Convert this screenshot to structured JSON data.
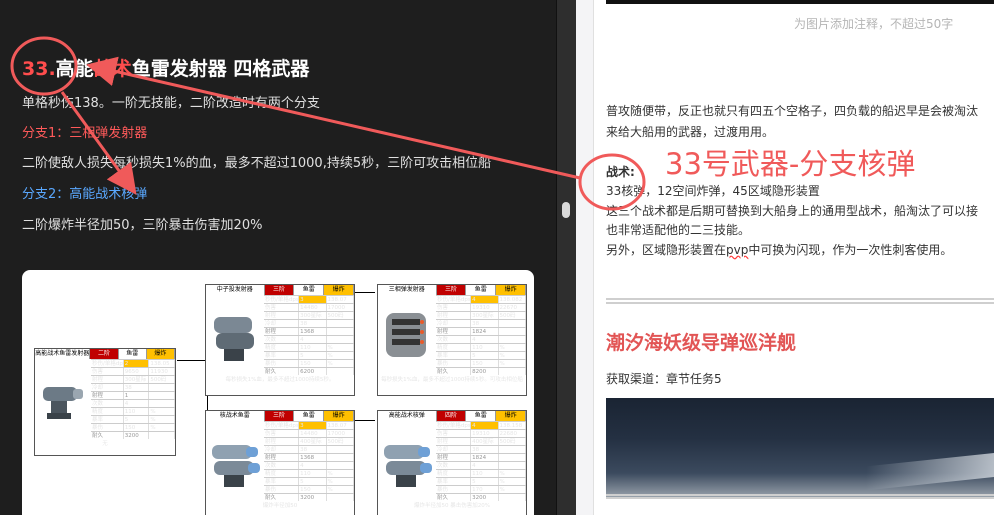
{
  "left": {
    "title_num": "33.",
    "title_a": "高能",
    "title_red": "战术",
    "title_b": "鱼雷发射器  四格武器",
    "line1": "单格秒伤138。一阶无技能，二阶改造时有两个分支",
    "branch1": "分支1：三相弹发射器",
    "line2": "二阶使敌人损失每秒损失1%的血，最多不超过1000,持续5秒，三阶可攻击相位船",
    "branch2": "分支2：高能战术核弹",
    "line3": "二阶爆炸半径加50，三阶暴击伤害加20%"
  },
  "sheets": {
    "main": {
      "name": "高能战术鱼雷发射器",
      "hdr_stage": "二阶",
      "hdr_base": "鱼雷",
      "hdr_var": "爆炸",
      "rows": [
        [
          "秒伤/单格dps",
          "2",
          "138.05"
        ],
        [
          "伤害",
          "9650",
          "11930"
        ],
        [
          "射程",
          "300星际",
          "500码"
        ],
        [
          "冷却",
          "38",
          ""
        ],
        [
          "射程",
          "1",
          ""
        ],
        [
          "次数",
          "4",
          ""
        ],
        [
          "精度",
          "110",
          "%"
        ],
        [
          "暴率",
          "5",
          "%"
        ],
        [
          "暴伤",
          "150",
          "%"
        ],
        [
          "耐久",
          "3200",
          ""
        ]
      ],
      "note": "无"
    },
    "mid_top": {
      "name": "中子投发射器",
      "hdr_stage": "三阶",
      "hdr_base": "鱼雷",
      "hdr_var": "爆炸",
      "rows": [
        [
          "秒伤/单格dps",
          "3",
          "138.07"
        ],
        [
          "伤害",
          "14480",
          "17000"
        ],
        [
          "射程",
          "300星际",
          "500码"
        ],
        [
          "冷却",
          "38",
          ""
        ],
        [
          "射程",
          "1368",
          ""
        ],
        [
          "次数",
          "4",
          ""
        ],
        [
          "精度",
          "110",
          "%"
        ],
        [
          "暴率",
          "5",
          "%"
        ],
        [
          "暴伤",
          "150",
          "%"
        ],
        [
          "耐久",
          "6200",
          ""
        ]
      ],
      "note": "每秒损失1%血，最多不超过1000持续5秒。"
    },
    "right_top": {
      "name": "三相弹发射器",
      "hdr_stage": "三阶",
      "hdr_base": "鱼雷",
      "hdr_var": "爆炸",
      "rows": [
        [
          "秒伤/单格dps",
          "4",
          "138.082"
        ],
        [
          "伤害",
          "19310",
          "22670"
        ],
        [
          "射程",
          "300星际",
          "500码"
        ],
        [
          "冷却",
          "38",
          ""
        ],
        [
          "射程",
          "1824",
          ""
        ],
        [
          "次数",
          "4",
          ""
        ],
        [
          "精度",
          "110",
          "%"
        ],
        [
          "暴率",
          "5",
          "%"
        ],
        [
          "暴伤",
          "150",
          "%"
        ],
        [
          "耐久",
          "8200",
          ""
        ]
      ],
      "note": "每秒损失1%血，最多不超过1000持续5秒。可攻击相位船"
    },
    "mid_bot": {
      "name": "核战术鱼雷",
      "hdr_stage": "三阶",
      "hdr_base": "鱼雷",
      "hdr_var": "爆炸",
      "rows": [
        [
          "秒伤/单格dps",
          "3",
          "138.07"
        ],
        [
          "伤害",
          "14480",
          "17000"
        ],
        [
          "射程",
          "400星际",
          "500码"
        ],
        [
          "冷却",
          "38",
          ""
        ],
        [
          "射程",
          "1368",
          ""
        ],
        [
          "次数",
          "4",
          ""
        ],
        [
          "精度",
          "110",
          "%"
        ],
        [
          "暴率",
          "5",
          "%"
        ],
        [
          "暴伤",
          "150",
          "%"
        ],
        [
          "耐久",
          "3200",
          ""
        ]
      ],
      "note": "爆炸半径加50"
    },
    "right_bot": {
      "name": "高能战术核弹",
      "hdr_stage": "四阶",
      "hdr_base": "鱼雷",
      "hdr_var": "爆炸",
      "rows": [
        [
          "秒伤/单格dps",
          "4",
          "138.158"
        ],
        [
          "伤害",
          "19310",
          "22680"
        ],
        [
          "射程",
          "400星际",
          "500码"
        ],
        [
          "冷却",
          "38",
          ""
        ],
        [
          "射程",
          "1824",
          ""
        ],
        [
          "次数",
          "4",
          ""
        ],
        [
          "精度",
          "110",
          "%"
        ],
        [
          "暴率",
          "5",
          "%"
        ],
        [
          "暴伤",
          "170",
          "%"
        ],
        [
          "耐久",
          "3200",
          ""
        ]
      ],
      "note": "爆炸半径加50 暴击伤害加20%"
    }
  },
  "right": {
    "caption": "为图片添加注释，不超过50字",
    "p1": "普攻随便带，反正也就只有四五个空格子，四负载的船迟早是会被淘汰",
    "p2": "来给大船用的武器，过渡用用。",
    "tactic_label": "战术:",
    "tactic_line_a": "33核弹，",
    "tactic_line_b": "12空间炸弹，45区域隐形装置",
    "p3": "这三个战术都是后期可替换到大船身上的通用型战术，船淘汰了可以接",
    "p4": "也非常适配他的二三技能。",
    "p5_a": "另外，区域隐形装置在",
    "p5_pvp": "pvp",
    "p5_b": "中可换为闪现，作为一次性刺客使用。",
    "ship_title": "潮汐海妖级导弹巡洋舰",
    "source": "获取渠道：章节任务5"
  },
  "annotation": {
    "label": "33号武器-分支核弹",
    "color": "#f05a5a"
  }
}
